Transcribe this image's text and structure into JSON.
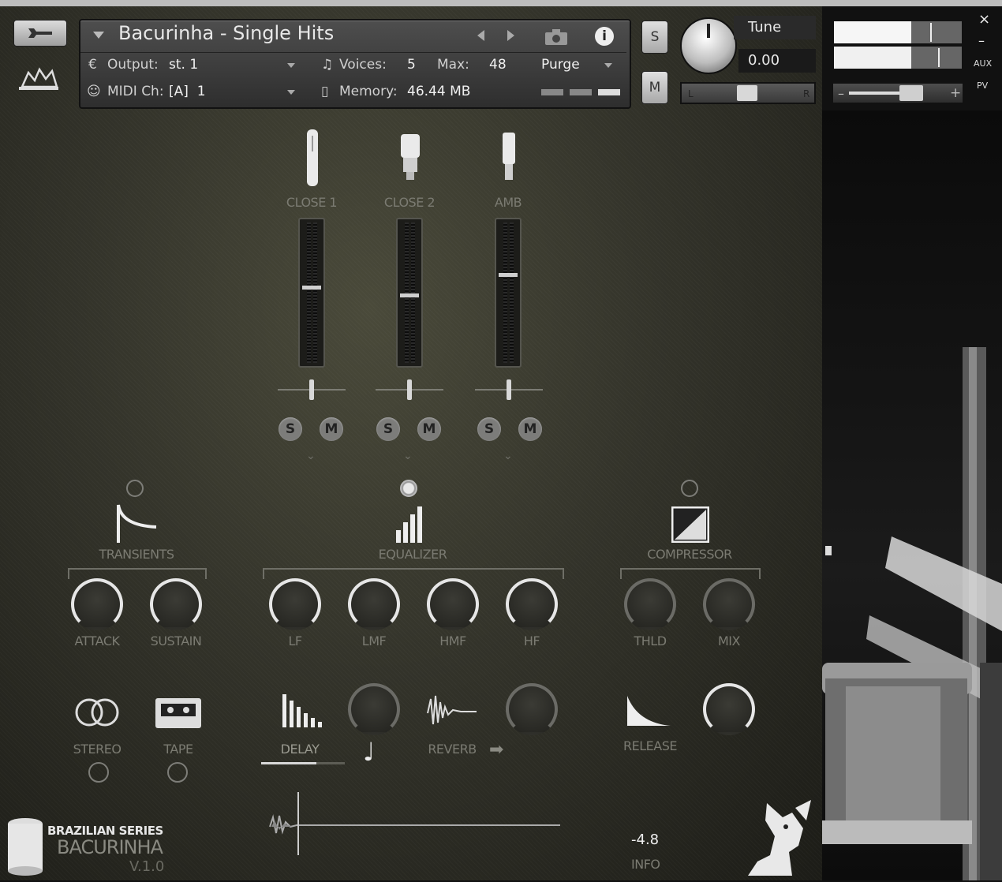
{
  "header": {
    "instrument_name": "Bacurinha - Single Hits",
    "output_label": "Output:",
    "output_value": "st. 1",
    "voices_label": "Voices:",
    "voices_value": "5",
    "max_label": "Max:",
    "max_value": "48",
    "purge_label": "Purge",
    "midi_label": "MIDI Ch:",
    "midi_value": "[A]  1",
    "memory_label": "Memory:",
    "memory_value": "46.44 MB",
    "solo_label": "S",
    "mute_label": "M",
    "tune_label": "Tune",
    "tune_value": "0.00",
    "pan_left": "L",
    "pan_right": "R",
    "aux_label": "AUX",
    "pv_label": "PV",
    "close_label": "×",
    "minimize_label": "–",
    "vol_minus": "–",
    "vol_plus": "+"
  },
  "mixer": {
    "channels": [
      {
        "name": "CLOSE 1",
        "solo": "S",
        "mute": "M"
      },
      {
        "name": "CLOSE 2",
        "solo": "S",
        "mute": "M"
      },
      {
        "name": "AMB",
        "solo": "S",
        "mute": "M"
      }
    ],
    "expand_glyph": "⌄"
  },
  "effects": {
    "transients": {
      "title": "TRANSIENTS",
      "attack": "ATTACK",
      "sustain": "SUSTAIN"
    },
    "equalizer": {
      "title": "EQUALIZER",
      "lf": "LF",
      "lmf": "LMF",
      "hmf": "HMF",
      "hf": "HF"
    },
    "compressor": {
      "title": "COMPRESSOR",
      "thld": "THLD",
      "mix": "MIX"
    },
    "stereo": "STEREO",
    "tape": "TAPE",
    "delay": "DELAY",
    "reverb": "REVERB",
    "release": "RELEASE",
    "note_glyph": "♩",
    "arrow_glyph": "➡"
  },
  "footer": {
    "series": "BRAZILIAN SERIES",
    "product": "BACURINHA",
    "version": "V.1.0",
    "info_value": "-4.8",
    "info_label": "INFO"
  }
}
